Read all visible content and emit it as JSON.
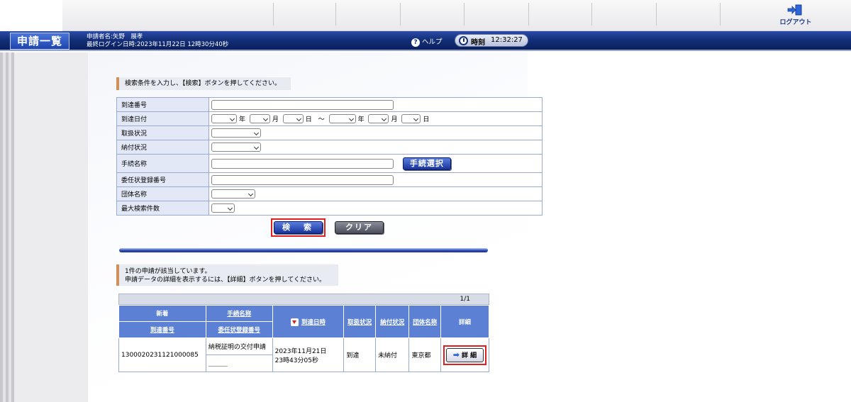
{
  "header": {
    "logout_label": "ログアウト"
  },
  "titlebar": {
    "title": "申請一覧",
    "user_line": "申請者名:矢野　展孝",
    "login_line": "最終ログイン日時:2023年11月22日 12時30分40秒",
    "help_label": "ヘルプ",
    "clock_label": "時刻",
    "clock_value": "12:32:27"
  },
  "search": {
    "instruction": "検索条件を入力し、【検索】ボタンを押してください。",
    "fields": {
      "arrival_no": "到達番号",
      "arrival_date": "到達日付",
      "status": "取扱状況",
      "payment": "納付状況",
      "procedure_name": "手続名称",
      "proxy_no": "委任状登録番号",
      "org_name": "団体名称",
      "max_results": "最大検索件数"
    },
    "date_units": {
      "year": "年",
      "month": "月",
      "day": "日",
      "tilde": "～"
    },
    "procedure_button": "手続選択",
    "search_button": "検　索",
    "clear_button": "クリア"
  },
  "results": {
    "message_line1": "1件の申請が該当しています。",
    "message_line2": "申請データの詳細を表示するには、【詳細】ボタンを押してください。",
    "page_indicator": "1/1",
    "headers": {
      "new": "新着",
      "arrival_no": "到達番号",
      "procedure_name": "手続名称",
      "proxy_no": "委任状登録番号",
      "arrival_datetime": "到達日時",
      "status": "取扱状況",
      "payment": "納付状況",
      "org": "団体名称",
      "detail": "詳細"
    },
    "rows": [
      {
        "arrival_no": "1300020231121000085",
        "procedure_name": "納税証明の交付申請",
        "proxy_no": "＿＿＿",
        "date_line1": "2023年11月21日",
        "date_line2": "23時43分05秒",
        "status": "到達",
        "payment": "未納付",
        "org": "東京都",
        "detail_label": "詳 細"
      }
    ]
  }
}
